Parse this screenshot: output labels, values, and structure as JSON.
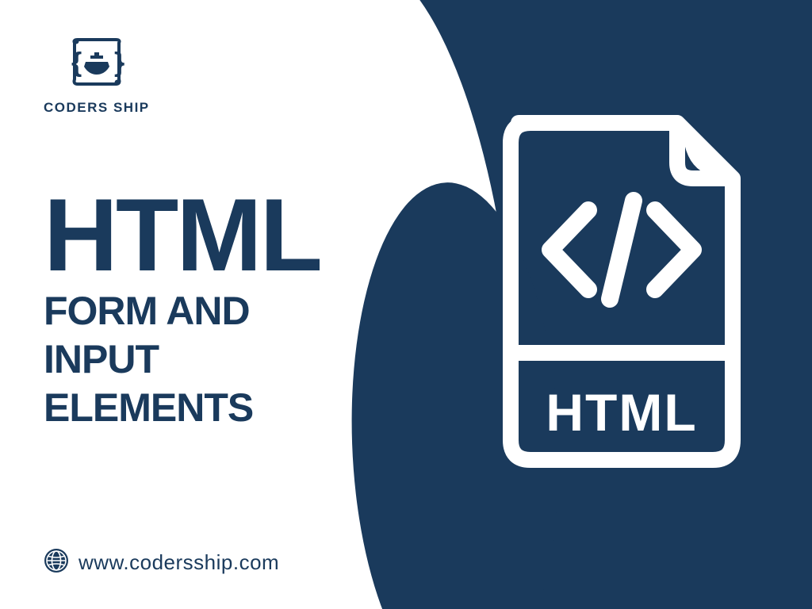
{
  "brand": {
    "name": "CODERS SHIP"
  },
  "headline": {
    "main": "HTML",
    "sub_line1": "FORM AND",
    "sub_line2": "INPUT",
    "sub_line3": "ELEMENTS"
  },
  "footer": {
    "url": "www.codersship.com"
  },
  "file_badge": {
    "label": "HTML"
  },
  "colors": {
    "navy": "#1a3a5c",
    "white": "#ffffff"
  }
}
